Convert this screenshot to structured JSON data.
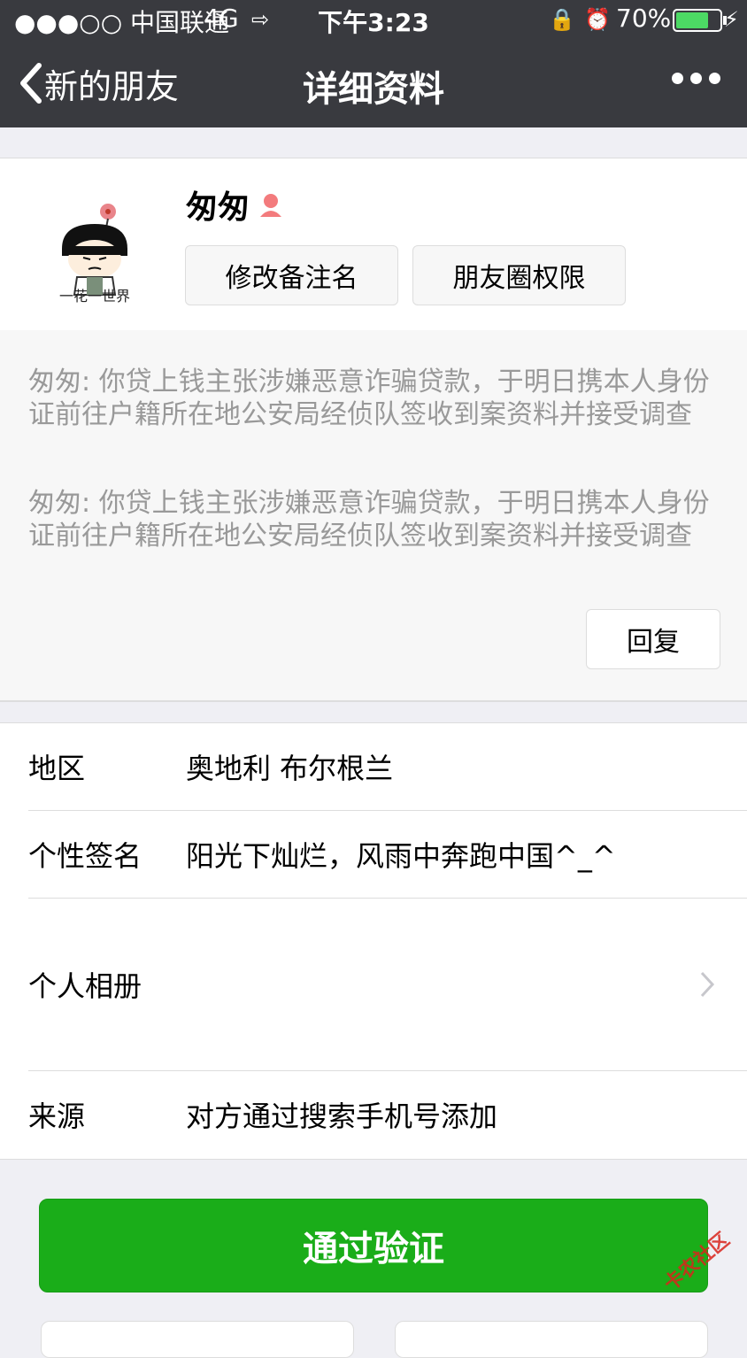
{
  "status": {
    "carrier": "●●●○○ 中国联通",
    "network": "4G",
    "time": "下午3:23",
    "battery": "70%"
  },
  "nav": {
    "back_label": "新的朋友",
    "title": "详细资料"
  },
  "profile": {
    "name": "匆匆",
    "avatar_caption": "一花一世界",
    "remark_button": "修改备注名",
    "moments_button": "朋友圈权限"
  },
  "messages": [
    "匆匆: 你贷上钱主张涉嫌恶意诈骗贷款，于明日携本人身份证前往户籍所在地公安局经侦队签收到案资料并接受调查",
    "匆匆: 你贷上钱主张涉嫌恶意诈骗贷款，于明日携本人身份证前往户籍所在地公安局经侦队签收到案资料并接受调查"
  ],
  "reply_button": "回复",
  "info": {
    "region_label": "地区",
    "region_value": "奥地利 布尔根兰",
    "signature_label": "个性签名",
    "signature_value": "阳光下灿烂，风雨中奔跑中国^_^",
    "album_label": "个人相册",
    "source_label": "来源",
    "source_value": "对方通过搜索手机号添加"
  },
  "verify_button": "通过验证",
  "watermark": "卡农社区",
  "colors": {
    "nav_bg": "#393a3f",
    "accent_green": "#1aad19",
    "female_icon": "#f37b7d"
  }
}
